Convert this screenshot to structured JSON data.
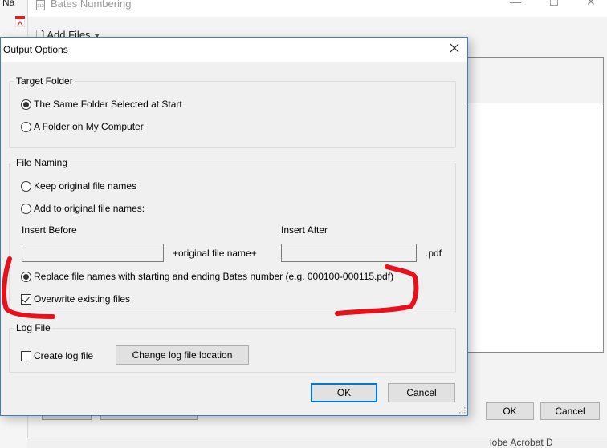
{
  "background_app": {
    "partial_label": "Na",
    "window_title": "Bates Numbering",
    "title_icon_text": "312",
    "window_controls": [
      "minimize",
      "maximize",
      "close"
    ],
    "toolbar": {
      "add_files_label": "Add Files"
    },
    "buttons": {
      "ok_label": "OK",
      "cancel_label": "Cancel"
    },
    "footer_text": "lobe Acrobat D"
  },
  "dialog": {
    "title": "Output Options",
    "target_folder": {
      "legend": "Target Folder",
      "options": [
        {
          "label": "The Same Folder Selected at Start",
          "checked": true
        },
        {
          "label": "A Folder on My Computer",
          "checked": false
        }
      ]
    },
    "file_naming": {
      "legend": "File Naming",
      "keep_original": {
        "label": "Keep original file names",
        "checked": false
      },
      "add_to_original": {
        "label": "Add to original file names:",
        "checked": false
      },
      "insert_before": {
        "label": "Insert Before",
        "value": ""
      },
      "middle_text": "+original file name+",
      "insert_after": {
        "label": "Insert After",
        "value": ""
      },
      "extension": ".pdf",
      "replace": {
        "label": "Replace file names with starting and ending Bates number (e.g. 000100-000115.pdf)",
        "checked": true
      },
      "overwrite": {
        "label": "Overwrite existing files",
        "checked": true
      }
    },
    "log_file": {
      "legend": "Log File",
      "create_log": {
        "label": "Create log file",
        "checked": false
      },
      "change_location_label": "Change log file location"
    },
    "buttons": {
      "ok_label": "OK",
      "cancel_label": "Cancel"
    }
  },
  "annotation": {
    "color": "#e8101a",
    "description": "red hand-drawn bracket highlighting the replace/overwrite options"
  }
}
